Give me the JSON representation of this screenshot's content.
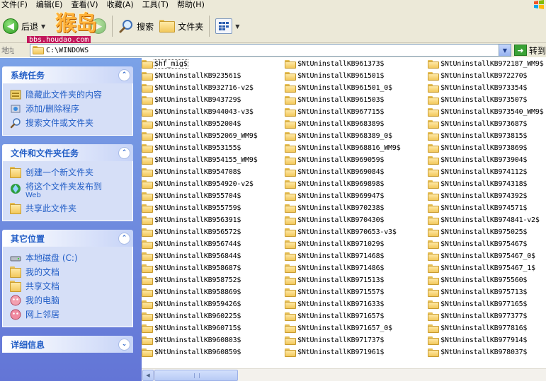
{
  "menu": {
    "items": [
      "文件(F)",
      "编辑(E)",
      "查看(V)",
      "收藏(A)",
      "工具(T)",
      "帮助(H)"
    ]
  },
  "toolbar": {
    "back_label": "后退",
    "search_label": "搜索",
    "folders_label": "文件夹"
  },
  "watermark": {
    "logo_text": "猴岛",
    "url_text": "bbs.houdao.com"
  },
  "address": {
    "label": "地址(D)",
    "value": "C:\\WINDOWS",
    "go_label": "转到"
  },
  "left_pane": {
    "system_tasks": {
      "title": "系统任务",
      "items": [
        {
          "label": "隐藏此文件夹的内容",
          "icon": "hide-contents-icon"
        },
        {
          "label": "添加/删除程序",
          "icon": "add-remove-programs-icon"
        },
        {
          "label": "搜索文件或文件夹",
          "icon": "search-icon"
        }
      ]
    },
    "file_tasks": {
      "title": "文件和文件夹任务",
      "items": [
        {
          "label": "创建一个新文件夹",
          "icon": "new-folder-icon"
        },
        {
          "label": "将这个文件夹发布到",
          "sub": "Web",
          "icon": "publish-web-icon"
        },
        {
          "label": "共享此文件夹",
          "icon": "share-folder-icon"
        }
      ]
    },
    "other_places": {
      "title": "其它位置",
      "items": [
        {
          "label": "本地磁盘 (C:)",
          "icon": "local-disk-icon"
        },
        {
          "label": "我的文档",
          "icon": "my-documents-icon"
        },
        {
          "label": "共享文档",
          "icon": "shared-documents-icon"
        },
        {
          "label": "我的电脑",
          "icon": "my-computer-icon"
        },
        {
          "label": "网上邻居",
          "icon": "network-places-icon"
        }
      ]
    },
    "details": {
      "title": "详细信息"
    }
  },
  "files": {
    "column1": [
      "$hf_mig$",
      "$NtUninstallKB923561$",
      "$NtUninstallKB932716-v2$",
      "$NtUninstallKB943729$",
      "$NtUninstallKB944043-v3$",
      "$NtUninstallKB952004$",
      "$NtUninstallKB952069_WM9$",
      "$NtUninstallKB953155$",
      "$NtUninstallKB954155_WM9$",
      "$NtUninstallKB954708$",
      "$NtUninstallKB954920-v2$",
      "$NtUninstallKB955704$",
      "$NtUninstallKB955759$",
      "$NtUninstallKB956391$",
      "$NtUninstallKB956572$",
      "$NtUninstallKB956744$",
      "$NtUninstallKB956844$",
      "$NtUninstallKB958687$",
      "$NtUninstallKB958752$",
      "$NtUninstallKB958869$",
      "$NtUninstallKB959426$",
      "$NtUninstallKB960225$",
      "$NtUninstallKB960715$",
      "$NtUninstallKB960803$",
      "$NtUninstallKB960859$"
    ],
    "column2": [
      "$NtUninstallKB961373$",
      "$NtUninstallKB961501$",
      "$NtUninstallKB961501_0$",
      "$NtUninstallKB961503$",
      "$NtUninstallKB967715$",
      "$NtUninstallKB968389$",
      "$NtUninstallKB968389_0$",
      "$NtUninstallKB968816_WM9$",
      "$NtUninstallKB969059$",
      "$NtUninstallKB969084$",
      "$NtUninstallKB969898$",
      "$NtUninstallKB969947$",
      "$NtUninstallKB970238$",
      "$NtUninstallKB970430$",
      "$NtUninstallKB970653-v3$",
      "$NtUninstallKB971029$",
      "$NtUninstallKB971468$",
      "$NtUninstallKB971486$",
      "$NtUninstallKB971513$",
      "$NtUninstallKB971557$",
      "$NtUninstallKB971633$",
      "$NtUninstallKB971657$",
      "$NtUninstallKB971657_0$",
      "$NtUninstallKB971737$",
      "$NtUninstallKB971961$"
    ],
    "column3": [
      "$NtUninstallKB972187_WM9$",
      "$NtUninstallKB972270$",
      "$NtUninstallKB973354$",
      "$NtUninstallKB973507$",
      "$NtUninstallKB973540_WM9$",
      "$NtUninstallKB973687$",
      "$NtUninstallKB973815$",
      "$NtUninstallKB973869$",
      "$NtUninstallKB973904$",
      "$NtUninstallKB974112$",
      "$NtUninstallKB974318$",
      "$NtUninstallKB974392$",
      "$NtUninstallKB974571$",
      "$NtUninstallKB974841-v2$",
      "$NtUninstallKB975025$",
      "$NtUninstallKB975467$",
      "$NtUninstallKB975467_0$",
      "$NtUninstallKB975467_1$",
      "$NtUninstallKB975560$",
      "$NtUninstallKB975713$",
      "$NtUninstallKB977165$",
      "$NtUninstallKB977377$",
      "$NtUninstallKB977816$",
      "$NtUninstallKB977914$",
      "$NtUninstallKB978037$"
    ]
  },
  "colors": {
    "pane_gradient_top": "#7ba2e7",
    "pane_gradient_bottom": "#6375d6",
    "task_link": "#215dc6",
    "folder_yellow": "#f2c85c"
  }
}
